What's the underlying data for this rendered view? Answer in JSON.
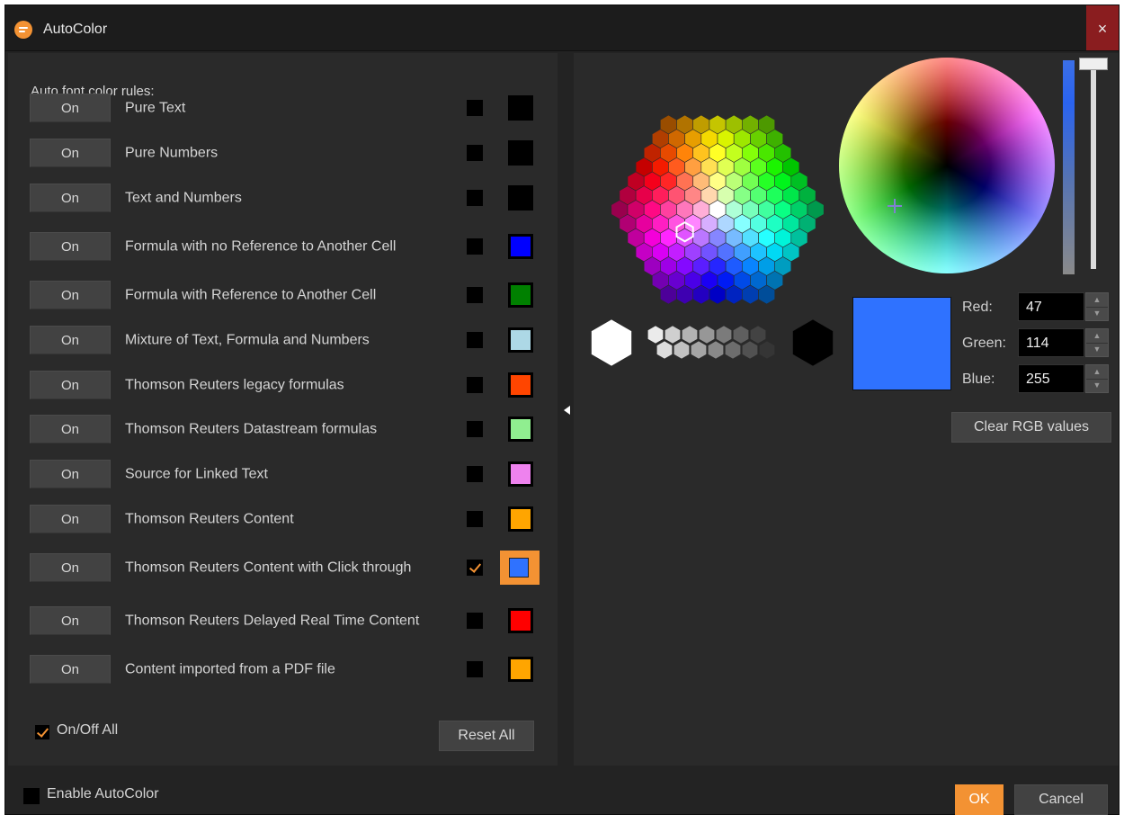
{
  "window": {
    "title": "AutoColor",
    "close_label": "×",
    "logo_icon": "app-logo-icon"
  },
  "left_panel": {
    "heading": "Auto font color rules:",
    "rules": [
      {
        "state": "On",
        "label": "Pure Text",
        "checked": false,
        "color": "#000000"
      },
      {
        "state": "On",
        "label": "Pure Numbers",
        "checked": false,
        "color": "#000000"
      },
      {
        "state": "On",
        "label": "Text and Numbers",
        "checked": false,
        "color": "#000000"
      },
      {
        "state": "On",
        "label": "Formula with no Reference to Another Cell",
        "checked": false,
        "color": "#0000ff"
      },
      {
        "state": "On",
        "label": "Formula with Reference to Another Cell",
        "checked": false,
        "color": "#008000"
      },
      {
        "state": "On",
        "label": "Mixture of Text, Formula and Numbers",
        "checked": false,
        "color": "#add8e6"
      },
      {
        "state": "On",
        "label": "Thomson Reuters legacy formulas",
        "checked": false,
        "color": "#ff4500"
      },
      {
        "state": "On",
        "label": "Thomson Reuters Datastream formulas",
        "checked": false,
        "color": "#90ee90"
      },
      {
        "state": "On",
        "label": "Source for Linked Text",
        "checked": false,
        "color": "#ee82ee"
      },
      {
        "state": "On",
        "label": "Thomson Reuters Content",
        "checked": false,
        "color": "#ffa500"
      },
      {
        "state": "On",
        "label": "Thomson Reuters Content with Click through",
        "checked": true,
        "color": "#2f72ff",
        "selected": true
      },
      {
        "state": "On",
        "label": "Thomson Reuters Delayed Real Time Content",
        "checked": false,
        "color": "#ff0000"
      },
      {
        "state": "On",
        "label": "Content imported from a PDF file",
        "checked": false,
        "color": "#ffa500"
      }
    ],
    "onoff_all_label": "On/Off All",
    "onoff_all_checked": true,
    "reset_all_label": "Reset All"
  },
  "color_picker": {
    "selected_color": "#2f72ff",
    "red_label": "Red:",
    "red": "47",
    "green_label": "Green:",
    "green": "114",
    "blue_label": "Blue:",
    "blue": "255",
    "clear_label": "Clear RGB values"
  },
  "footer": {
    "enable_label": "Enable AutoColor",
    "enable_checked": false,
    "ok_label": "OK",
    "cancel_label": "Cancel"
  },
  "colors": {
    "accent": "#f39233",
    "close_bg": "#8a1d1f"
  }
}
